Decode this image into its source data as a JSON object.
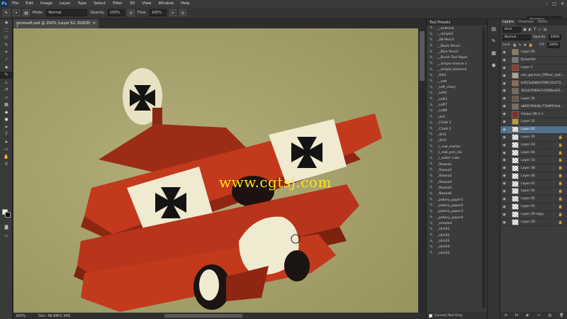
{
  "app": {
    "logo": "Ps"
  },
  "menu": [
    "File",
    "Edit",
    "Image",
    "Layer",
    "Type",
    "Select",
    "Filter",
    "3D",
    "View",
    "Window",
    "Help"
  ],
  "window_controls": [
    "–",
    "□",
    "✕"
  ],
  "options": {
    "mode_label": "Mode:",
    "mode_value": "Normal",
    "opacity_label": "Opacity:",
    "opacity_value": "100%",
    "flow_label": "Flow:",
    "flow_value": "100%",
    "workspace": "Painting"
  },
  "document": {
    "tab_title": "genevafi.psd @ 200% (Layer 62, RGB/8) *",
    "tab_close": "×",
    "watermark": "www.cgtsj.com",
    "zoom": "200%",
    "doc_size": "Doc: 49.8M/1.34G"
  },
  "tool_presets": {
    "title": "Tool Presets",
    "items": [
      "__airbrush",
      "__simple1",
      "_2B Pencil",
      "__Black Pencil",
      "__Blue Pencil",
      "__Brush Tool Paper",
      "__simple texture 1",
      "__simple_texture2",
      "_flat1",
      "__soft",
      "_soft_chary",
      "_soft2",
      "_soft3",
      "_soft7",
      "_soft8",
      "_airh",
      "_Chalk 1",
      "_Chalk 2",
      "_dirt1",
      "_dirt2",
      "_l_real_marker",
      "_l_real_pen_ink",
      "_l_water color",
      "_flowaa1",
      "_flowaa2",
      "_flowaa3",
      "_flowaa4",
      "_flowaa5",
      "_flowaa6",
      "_pokery_paper1",
      "_pokery_paper2",
      "_pokery_paper3",
      "_pokery_paper4",
      "_simple4",
      "_skin01",
      "_skin02",
      "_skin03",
      "_skin04",
      "_skin05"
    ],
    "footer_label": "Current Tool Only"
  },
  "layers_panel": {
    "tabs": [
      "Layers",
      "Channels",
      "Paths"
    ],
    "filter_kind": "Kind",
    "blend_mode": "Normal",
    "opacity_label": "Opacity:",
    "opacity_value": "100%",
    "lock_label": "Lock:",
    "fill_label": "Fill:",
    "fill_value": "100%",
    "layers": [
      {
        "name": "Layer 60",
        "thumb": "#8a7e5a"
      },
      {
        "name": "DriverArt",
        "thumb": "#777"
      },
      {
        "name": "Layer 1",
        "thumb": "#9b3a22"
      },
      {
        "name": "von_german_Officer_sydi...",
        "thumb": "#b0a48a"
      },
      {
        "name": "b/923a0dbfcf208c1fc272...",
        "thumb": "#8a6d55"
      },
      {
        "name": "3b1dc5960e7d16f8ea53...",
        "thumb": "#7e6a52"
      },
      {
        "name": "Layer 34",
        "thumb": "#6e5a45"
      },
      {
        "name": "a8607f0440c77b9f91fcb...",
        "thumb": "#806e58"
      },
      {
        "name": "Fokker DR-1-1",
        "thumb": "#8b2b1c"
      },
      {
        "name": "Layer 31",
        "thumb": "#c19a27"
      },
      {
        "name": "Layer 62",
        "thumb": "trans"
      },
      {
        "name": "Layer 35",
        "thumb": "trans"
      },
      {
        "name": "Layer 43",
        "thumb": "trans"
      },
      {
        "name": "Layer 44",
        "thumb": "trans"
      },
      {
        "name": "Layer 31",
        "thumb": "trans"
      },
      {
        "name": "Layer 38",
        "thumb": "trans"
      },
      {
        "name": "Layer 40",
        "thumb": "trans"
      },
      {
        "name": "Layer 41",
        "thumb": "trans"
      },
      {
        "name": "Layer 42",
        "thumb": "trans"
      },
      {
        "name": "Layer 45",
        "thumb": "trans"
      },
      {
        "name": "Layer 61",
        "thumb": "trans"
      },
      {
        "name": "Layer 29 copy",
        "thumb": "trans"
      },
      {
        "name": "Layer 29",
        "thumb": "trans"
      }
    ],
    "selected_index": 10,
    "footer_icons": [
      "⊝",
      "fx",
      "◐",
      "▭",
      "▤",
      "🗑"
    ]
  },
  "colors": {
    "canvas_bg": "#a6a26f",
    "plane_red": "#c2391c",
    "cream": "#f0ead0",
    "cross": "#141414",
    "watermark": "#ffe21a",
    "selected_layer": "#52708f"
  }
}
